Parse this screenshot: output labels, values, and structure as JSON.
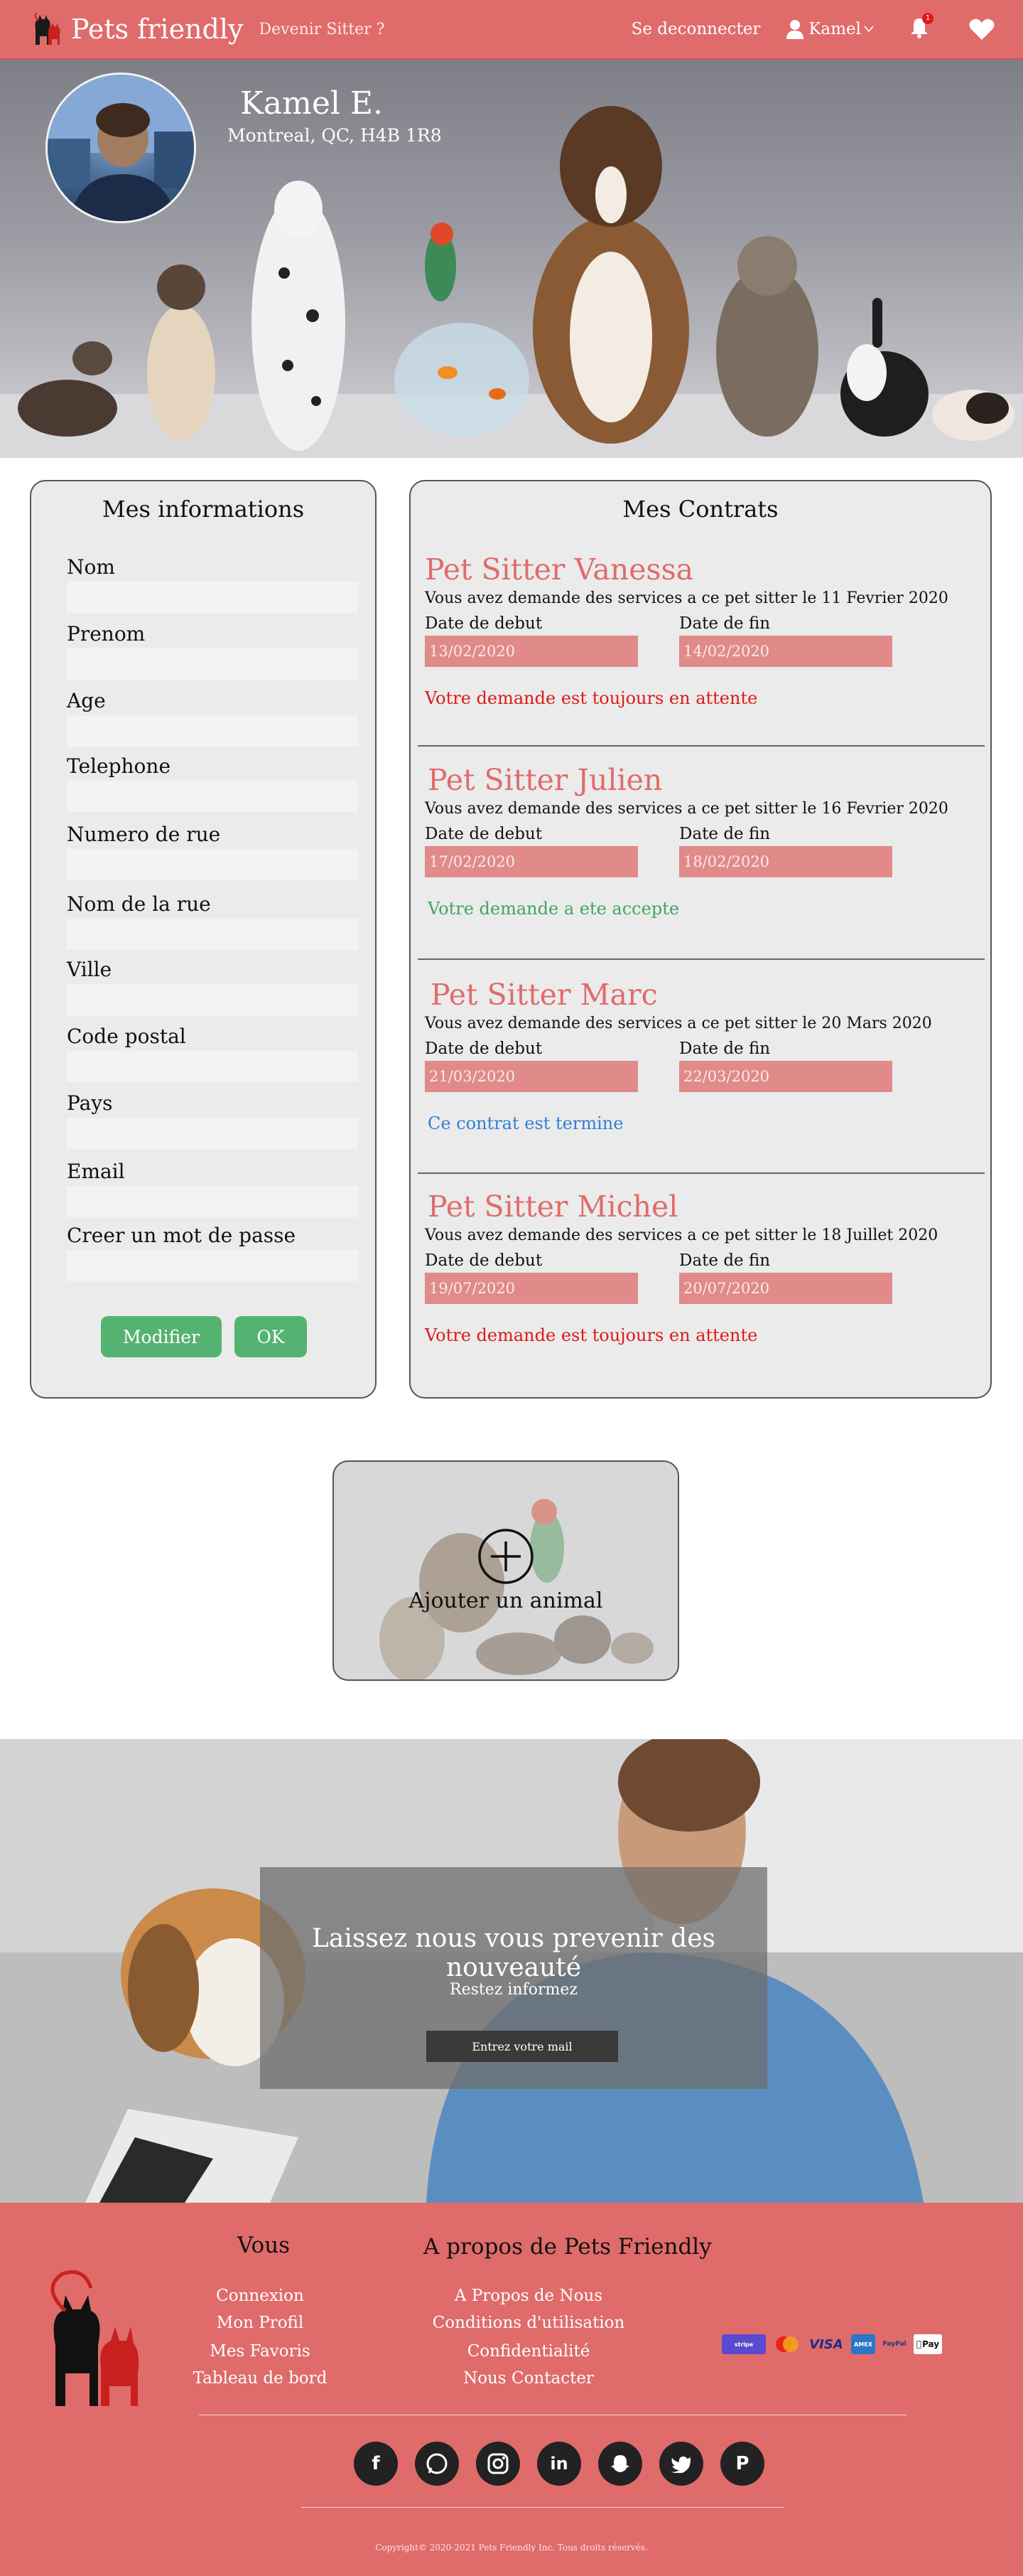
{
  "nav": {
    "brand": "Pets friendly",
    "become_sitter": "Devenir Sitter ?",
    "logout": "Se deconnecter",
    "user": "Kamel",
    "notifications_count": "1",
    "icons": [
      "user-icon",
      "caret-down-icon",
      "bell-icon",
      "heart-icon"
    ]
  },
  "profile": {
    "name": "Kamel E.",
    "address": "Montreal, QC, H4B 1R8"
  },
  "info": {
    "title": "Mes informations",
    "fields": [
      {
        "label": "Nom",
        "value": ""
      },
      {
        "label": "Prenom",
        "value": ""
      },
      {
        "label": "Age",
        "value": ""
      },
      {
        "label": "Telephone",
        "value": ""
      },
      {
        "label": "Numero de rue",
        "value": ""
      },
      {
        "label": "Nom de la rue",
        "value": ""
      },
      {
        "label": "Ville",
        "value": ""
      },
      {
        "label": "Code postal",
        "value": ""
      },
      {
        "label": "Pays",
        "value": ""
      },
      {
        "label": "Email",
        "value": ""
      },
      {
        "label": "Creer un mot de passe",
        "value": ""
      }
    ],
    "modify_label": "Modifier",
    "ok_label": "OK"
  },
  "contracts": {
    "title": "Mes Contrats",
    "start_label": "Date de debut",
    "end_label": "Date de fin",
    "items": [
      {
        "title": "Pet Sitter Vanessa",
        "description": "Vous avez demande des services a ce pet sitter le 11 Fevrier 2020",
        "start": "13/02/2020",
        "end": "14/02/2020",
        "status": "Votre demande est toujours en attente",
        "status_color": "#e01818"
      },
      {
        "title": "Pet Sitter Julien",
        "description": "Vous avez demande des services a ce pet sitter le 16 Fevrier 2020",
        "start": "17/02/2020",
        "end": "18/02/2020",
        "status": "Votre demande a ete accepte",
        "status_color": "#3fa660"
      },
      {
        "title": "Pet Sitter Marc",
        "description": "Vous avez demande des services a ce pet sitter le 20 Mars 2020",
        "start": "21/03/2020",
        "end": "22/03/2020",
        "status": "Ce contrat est termine",
        "status_color": "#2f7fd6"
      },
      {
        "title": "Pet Sitter Michel",
        "description": "Vous avez demande des services a ce pet sitter le 18 Juillet 2020",
        "start": "19/07/2020",
        "end": "20/07/2020",
        "status": "Votre demande est toujours en attente",
        "status_color": "#e01818"
      }
    ]
  },
  "add_animal": {
    "label": "Ajouter un animal",
    "icon": "plus-circle-icon"
  },
  "newsletter": {
    "title": "Laissez nous vous prevenir des nouveauté",
    "subtitle": "Restez informez",
    "input_placeholder": "Entrez votre mail"
  },
  "footer": {
    "col1_title": "Vous",
    "col1_links": [
      "Connexion",
      "Mon Profil",
      "Mes Favoris",
      "Tableau de bord"
    ],
    "col2_title": "A propos de Pets Friendly",
    "col2_links": [
      "A Propos de Nous",
      "Conditions d'utilisation",
      "Confidentialité",
      "Nous Contacter"
    ],
    "payments": [
      "stripe",
      "mastercard",
      "VISA",
      "AMEX",
      "PayPal",
      "Pay"
    ],
    "socials": [
      "facebook-icon",
      "whatsapp-icon",
      "instagram-icon",
      "linkedin-icon",
      "snapchat-icon",
      "twitter-icon",
      "pinterest-icon"
    ],
    "copyright": "Copyright© 2020-2021 Pets Friendly Inc. Tous droits réservés."
  },
  "colors": {
    "brand": "#e06b6b",
    "button_green": "#55b371",
    "date_input": "#e08a8a"
  }
}
